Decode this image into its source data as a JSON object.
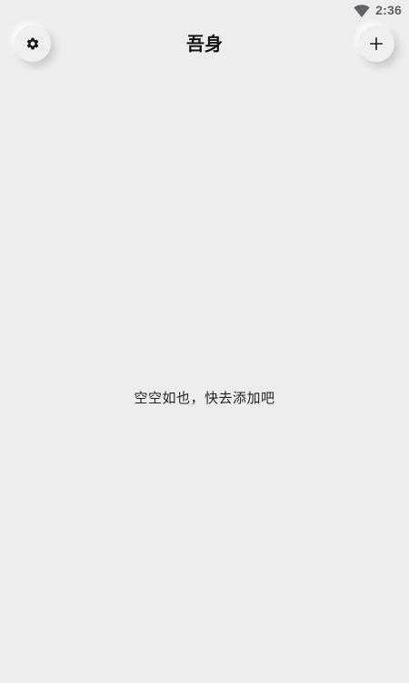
{
  "status_bar": {
    "time": "2:36",
    "wifi_icon": "wifi-icon"
  },
  "app_bar": {
    "title": "吾身",
    "settings_icon": "gear-icon",
    "add_icon": "plus-icon"
  },
  "main": {
    "empty_message": "空空如也，快去添加吧"
  },
  "colors": {
    "background": "#eceeed",
    "button_surface": "#eef0ef",
    "title_text": "#111111",
    "status_text": "#5f6368"
  }
}
